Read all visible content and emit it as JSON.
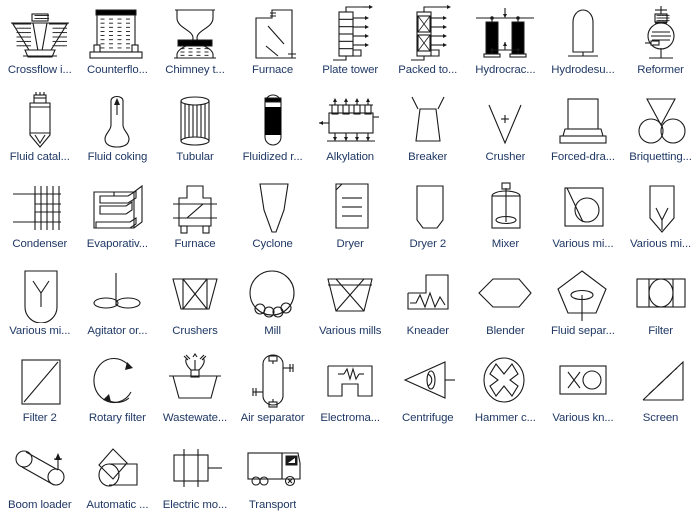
{
  "palette": {
    "title": "Process Equipment Shapes",
    "columns": 9,
    "rows": 6,
    "text_color": "#1f3864",
    "line_color": "#1a1a1a",
    "background_color": "#ffffff",
    "items": [
      {
        "id": "crossflow-induced-draft-cooling-tower",
        "label": "Crossflow i...",
        "icon": "crossflow-cooling-tower-icon"
      },
      {
        "id": "counterflow-cooling-tower",
        "label": "Counterflo...",
        "icon": "counterflow-cooling-tower-icon"
      },
      {
        "id": "chimney-tower",
        "label": "Chimney t...",
        "icon": "chimney-tower-icon"
      },
      {
        "id": "furnace",
        "label": "Furnace",
        "icon": "furnace-icon"
      },
      {
        "id": "plate-tower",
        "label": "Plate tower",
        "icon": "plate-tower-icon"
      },
      {
        "id": "packed-tower",
        "label": "Packed to...",
        "icon": "packed-tower-icon"
      },
      {
        "id": "hydrocracking-unit",
        "label": "Hydrocrac...",
        "icon": "hydrocracking-icon"
      },
      {
        "id": "hydrodesulfurization-unit",
        "label": "Hydrodesu...",
        "icon": "hydrodesulfurization-icon"
      },
      {
        "id": "reformer",
        "label": "Reformer",
        "icon": "reformer-icon"
      },
      {
        "id": "fluid-catalytic-cracking",
        "label": "Fluid catal...",
        "icon": "fluid-catalytic-cracking-icon"
      },
      {
        "id": "fluid-coking",
        "label": "Fluid coking",
        "icon": "fluid-coking-icon"
      },
      {
        "id": "tubular",
        "label": "Tubular",
        "icon": "tubular-icon"
      },
      {
        "id": "fluidized-reactor",
        "label": "Fluidized r...",
        "icon": "fluidized-reactor-icon"
      },
      {
        "id": "alkylation",
        "label": "Alkylation",
        "icon": "alkylation-icon"
      },
      {
        "id": "breaker",
        "label": "Breaker",
        "icon": "breaker-icon"
      },
      {
        "id": "crusher",
        "label": "Crusher",
        "icon": "crusher-icon"
      },
      {
        "id": "forced-draft-cooling-tower",
        "label": "Forced-dra...",
        "icon": "forced-draft-icon"
      },
      {
        "id": "briquetting-machine",
        "label": "Briquetting...",
        "icon": "briquetting-icon"
      },
      {
        "id": "condenser",
        "label": "Condenser",
        "icon": "condenser-icon"
      },
      {
        "id": "evaporative-condenser",
        "label": "Evaporativ...",
        "icon": "evaporative-condenser-icon"
      },
      {
        "id": "furnace-2",
        "label": "Furnace",
        "icon": "furnace-box-icon"
      },
      {
        "id": "cyclone",
        "label": "Cyclone",
        "icon": "cyclone-icon"
      },
      {
        "id": "dryer",
        "label": "Dryer",
        "icon": "dryer-icon"
      },
      {
        "id": "dryer-2",
        "label": "Dryer 2",
        "icon": "dryer-2-icon"
      },
      {
        "id": "mixer",
        "label": "Mixer",
        "icon": "mixer-icon"
      },
      {
        "id": "various-mixers-1",
        "label": "Various mi...",
        "icon": "various-mixer-square-icon"
      },
      {
        "id": "various-mixers-2",
        "label": "Various mi...",
        "icon": "various-mixer-pointed-icon"
      },
      {
        "id": "various-mixers-3",
        "label": "Various mi...",
        "icon": "various-mixer-y-icon"
      },
      {
        "id": "agitator-or-stirrer",
        "label": "Agitator or...",
        "icon": "agitator-icon"
      },
      {
        "id": "crushers",
        "label": "Crushers",
        "icon": "crushers-icon"
      },
      {
        "id": "mill",
        "label": "Mill",
        "icon": "mill-icon"
      },
      {
        "id": "various-mills",
        "label": "Various mills",
        "icon": "various-mills-icon"
      },
      {
        "id": "kneader",
        "label": "Kneader",
        "icon": "kneader-icon"
      },
      {
        "id": "blender",
        "label": "Blender",
        "icon": "blender-icon"
      },
      {
        "id": "fluid-separator",
        "label": "Fluid separ...",
        "icon": "fluid-separator-icon"
      },
      {
        "id": "filter",
        "label": "Filter",
        "icon": "filter-icon"
      },
      {
        "id": "filter-2",
        "label": "Filter 2",
        "icon": "filter-2-icon"
      },
      {
        "id": "rotary-filter",
        "label": "Rotary filter",
        "icon": "rotary-filter-icon"
      },
      {
        "id": "wastewater-treatment",
        "label": "Wastewate...",
        "icon": "wastewater-icon"
      },
      {
        "id": "air-separator",
        "label": "Air separator",
        "icon": "air-separator-icon"
      },
      {
        "id": "electromagnetic-separator",
        "label": "Electroma...",
        "icon": "electromagnetic-icon"
      },
      {
        "id": "centrifuge",
        "label": "Centrifuge",
        "icon": "centrifuge-icon"
      },
      {
        "id": "hammer-crusher",
        "label": "Hammer c...",
        "icon": "hammer-crusher-icon"
      },
      {
        "id": "various-knives",
        "label": "Various kn...",
        "icon": "various-knives-icon"
      },
      {
        "id": "screen",
        "label": "Screen",
        "icon": "screen-icon"
      },
      {
        "id": "boom-loader",
        "label": "Boom loader",
        "icon": "boom-loader-icon"
      },
      {
        "id": "automatic-loader",
        "label": "Automatic ...",
        "icon": "automatic-loader-icon"
      },
      {
        "id": "electric-motor",
        "label": "Electric mo...",
        "icon": "electric-motor-icon"
      },
      {
        "id": "transport",
        "label": "Transport",
        "icon": "transport-truck-icon"
      }
    ]
  }
}
